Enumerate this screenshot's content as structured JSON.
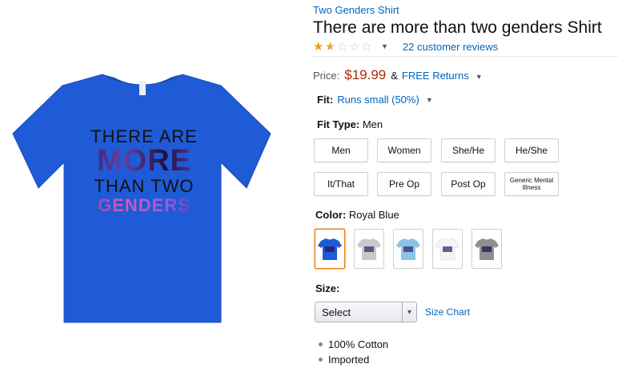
{
  "product": {
    "brand": "Two Genders Shirt",
    "title": "There are more than two genders Shirt",
    "rating": 1.5,
    "rating_max": 5,
    "reviews": "22 customer reviews",
    "image_text": [
      "THERE ARE",
      "MORE",
      "THAN TWO",
      "GENDERS"
    ],
    "shirt_color": "#1f5bd6"
  },
  "price": {
    "label": "Price:",
    "value": "$19.99",
    "amp": "&",
    "returns": "FREE Returns",
    "color": "#b12704"
  },
  "fit": {
    "label": "Fit:",
    "value": "Runs small (50%)"
  },
  "fit_type": {
    "label": "Fit Type:",
    "value": "Men",
    "options": [
      "Men",
      "Women",
      "She/He",
      "He/She",
      "It/That",
      "Pre Op",
      "Post Op",
      "Generic Mental Illness"
    ]
  },
  "color": {
    "label": "Color:",
    "value": "Royal Blue",
    "swatches": [
      {
        "name": "Royal Blue",
        "hex": "#1f5bd6"
      },
      {
        "name": "Silver",
        "hex": "#c9c9cb"
      },
      {
        "name": "Baby Blue",
        "hex": "#8ec3e8"
      },
      {
        "name": "White",
        "hex": "#f4f4f4"
      },
      {
        "name": "Heather Grey",
        "hex": "#8f8f8f"
      }
    ]
  },
  "size": {
    "label": "Size:",
    "select": "Select",
    "chart_link": "Size Chart"
  },
  "bullets": [
    "100% Cotton",
    "Imported"
  ],
  "theme": {
    "link": "#0066c0",
    "star": "#f0a000",
    "selected_border": "#e77600"
  }
}
